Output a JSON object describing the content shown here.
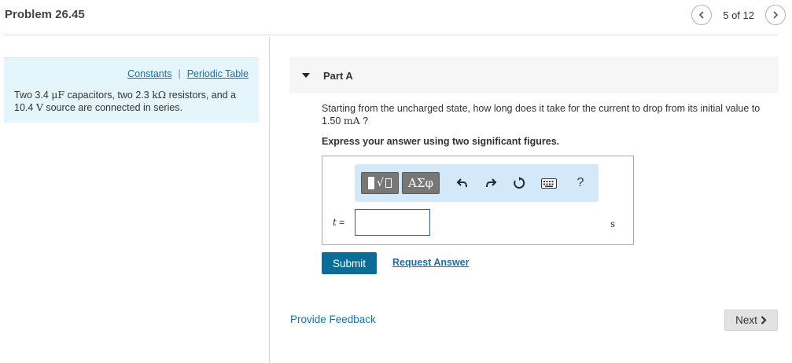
{
  "header": {
    "title": "Problem 26.45",
    "pager_text": "5 of 12",
    "prev_icon": "chevron-left-icon",
    "next_icon": "chevron-right-icon"
  },
  "sidebar": {
    "links": [
      "Constants",
      "Periodic Table"
    ],
    "separator": "|",
    "problem_text": {
      "p1": "Two 3.4 ",
      "m1": "μF",
      "p2": " capacitors, two 2.3 ",
      "m2": "kΩ",
      "p3": " resistors, and a 10.4 ",
      "m3": "V",
      "p4": " source are connected in series."
    },
    "background_color": "#e4f6fb"
  },
  "part": {
    "label": "Part A",
    "question": {
      "p1": "Starting from the uncharged state, how long does it take for the current to drop from its initial value to",
      "value": "1.50 ",
      "unit": "mA",
      "p2": " ?"
    },
    "instruction": "Express your answer using two significant figures."
  },
  "answer": {
    "variable": "t",
    "equals": "=",
    "value": "",
    "placeholder": "",
    "unit": "s",
    "toolbar": {
      "template_icon": "templates-radical-icon",
      "greek_label": "ΑΣφ",
      "undo_icon": "undo-icon",
      "redo_icon": "redo-icon",
      "reset_icon": "reset-icon",
      "keyboard_icon": "keyboard-icon",
      "help_label": "?"
    }
  },
  "actions": {
    "submit_label": "Submit",
    "request_label": "Request Answer"
  },
  "footer": {
    "feedback_label": "Provide Feedback",
    "next_label": "Next"
  },
  "colors": {
    "accent": "#0b6d97",
    "link": "#1b6fa6",
    "toolbar_bg": "#d3e8f8",
    "part_header_bg": "#f6f6f6"
  }
}
